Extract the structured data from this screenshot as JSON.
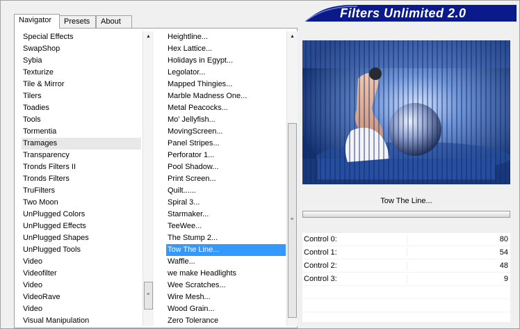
{
  "app": {
    "logo_text": "Filters Unlimited 2.0"
  },
  "tabs": [
    {
      "label": "Navigator",
      "active": true
    },
    {
      "label": "Presets",
      "active": false
    },
    {
      "label": "About",
      "active": false
    }
  ],
  "categories": {
    "items": [
      "Special Effects",
      "SwapShop",
      "Sybia",
      "Texturize",
      "Tile & Mirror",
      "Tilers",
      "Toadies",
      "Tools",
      "Tormentia",
      "Tramages",
      "Transparency",
      "Tronds Filters II",
      "Tronds Filters",
      "TruFilters",
      "Two Moon",
      "UnPlugged Colors",
      "UnPlugged Effects",
      "UnPlugged Shapes",
      "UnPlugged Tools",
      "Video",
      "Videofilter",
      "Video",
      "VideoRave",
      "Video",
      "Visual Manipulation"
    ],
    "highlighted": "Tramages",
    "scroll_position": 0.9
  },
  "filters": {
    "items": [
      "Heightline...",
      "Hex Lattice...",
      "Holidays in Egypt...",
      "Legolator...",
      "Mapped Thingies...",
      "Marble Madness One...",
      "Metal Peacocks...",
      "Mo' Jellyfish...",
      "MovingScreen...",
      "Panel Stripes...",
      "Perforator 1...",
      "Pool Shadow...",
      "Print Screen...",
      "Quilt......",
      "Spiral 3...",
      "Starmaker...",
      "TeeWee...",
      "The Stump 2...",
      "Tow The Line...",
      "Waffle...",
      "we make Headlights",
      "Wee Scratches...",
      "Wire Mesh...",
      "Wood Grain...",
      "Zero Tolerance"
    ],
    "selected": "Tow The Line...",
    "scroll_position": 0.55
  },
  "preview": {
    "filter_name": "Tow The Line..."
  },
  "controls": [
    {
      "label": "Control 0:",
      "value": "80"
    },
    {
      "label": "Control 1:",
      "value": "54"
    },
    {
      "label": "Control 2:",
      "value": "48"
    },
    {
      "label": "Control 3:",
      "value": "9"
    }
  ],
  "colors": {
    "logo_bg": "#0a1a8a",
    "selection": "#3399ff",
    "preview_blue": "#1d3f86"
  }
}
